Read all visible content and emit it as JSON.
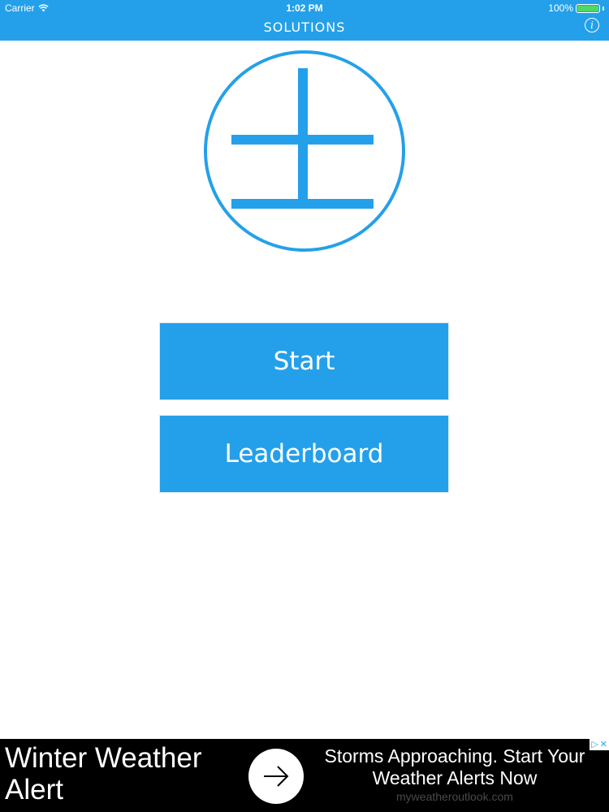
{
  "status_bar": {
    "carrier": "Carrier",
    "time": "1:02 PM",
    "battery": "100%",
    "battery_level": 1.0
  },
  "nav": {
    "title": "SOLUTIONS",
    "info_icon": "info-icon",
    "info_glyph": "i"
  },
  "logo": {
    "icon": "earth-glyph-logo",
    "color": "#24a0ea"
  },
  "menu": {
    "start_label": "Start",
    "leaderboard_label": "Leaderboard"
  },
  "ad": {
    "headline": "Winter Weather Alert",
    "body": "Storms Approaching. Start Your Weather Alerts Now",
    "url": "myweatheroutlook.com",
    "arrow_icon": "arrow-right-icon",
    "choices_icons": [
      "adchoices-icon",
      "close-icon"
    ]
  },
  "colors": {
    "accent": "#24a0ea",
    "ad_background": "#000000",
    "battery": "#4cd964"
  }
}
